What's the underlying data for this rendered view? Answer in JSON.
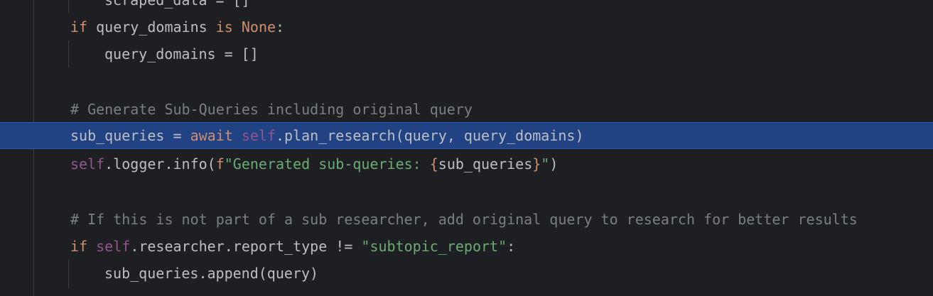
{
  "lines": [
    {
      "id": "l0",
      "text": "scraped_data = []"
    },
    {
      "id": "l1",
      "kw_if": "if",
      "var": " query_domains ",
      "kw_is": "is",
      "space": " ",
      "kw_none": "None",
      "colon": ":"
    },
    {
      "id": "l2",
      "text": "query_domains = []"
    },
    {
      "id": "l3",
      "comment": "# Generate Sub-Queries including original query"
    },
    {
      "id": "l4",
      "lhs": "sub_queries = ",
      "kw_await": "await",
      "space": " ",
      "self": "self",
      "rest": ".plan_research(query, query_domains)"
    },
    {
      "id": "l5",
      "self": "self",
      "mid": ".logger.info(",
      "fprefix": "f",
      "str_open": "\"Generated sub-queries: ",
      "brace_open": "{",
      "inner": "sub_queries",
      "brace_close": "}",
      "str_close": "\"",
      "close": ")"
    },
    {
      "id": "l6",
      "comment": "# If this is not part of a sub researcher, add original query to research for better results"
    },
    {
      "id": "l7",
      "kw_if": "if",
      "space": " ",
      "self": "self",
      "mid": ".researcher.report_type != ",
      "str": "\"subtopic_report\"",
      "colon": ":"
    },
    {
      "id": "l8",
      "text": "sub_queries.append(query)"
    }
  ],
  "colors": {
    "background": "#1e1f22",
    "text": "#bcbec4",
    "keyword": "#cf8e6d",
    "self": "#94558d",
    "string": "#6aab73",
    "comment": "#7a7e85",
    "current_line": "#214283"
  }
}
